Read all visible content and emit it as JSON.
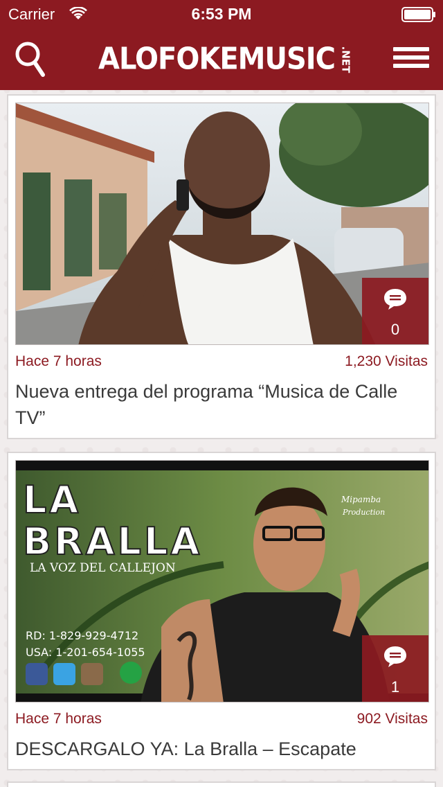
{
  "status_bar": {
    "carrier": "Carrier",
    "time": "6:53 PM"
  },
  "nav": {
    "logo_main": "ALOFOKEMUSIC",
    "logo_suffix": ".NET",
    "search_icon": "search-icon",
    "menu_icon": "hamburger-menu-icon",
    "color": "#8c1a21"
  },
  "posts": [
    {
      "time_ago": "Hace 7 horas",
      "visits": "1,230 Visitas",
      "title": "Nueva entrega del programa “Musica de Calle TV”",
      "comments": "0",
      "image": "man-on-phone-street-photo"
    },
    {
      "time_ago": "Hace 7 horas",
      "visits": "902 Visitas",
      "title": "DESCARGALO YA: La Bralla – Escapate",
      "comments": "1",
      "image": "la-bralla-promo-flyer",
      "flyer": {
        "line1": "LA",
        "line2": "BRALLA",
        "tagline": "LA VOZ DEL CALLEJON",
        "phone_rd": "RD: 1-829-929-4712",
        "phone_usa": "USA: 1-201-654-1055",
        "producer_line1": "Mipamba",
        "producer_line2": "Production"
      }
    }
  ]
}
